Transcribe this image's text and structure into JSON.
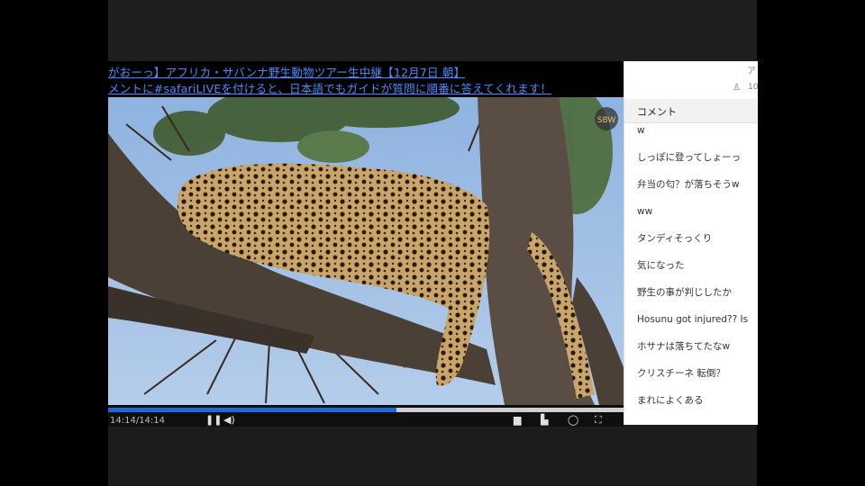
{
  "stream": {
    "title_line1": "がおーっ】アフリカ・サバンナ野生動物ツアー生中継【12月7日 朝】",
    "title_line2": "メントに#safariLIVEを付けると、日本語でもガイドが質問に順番に答えてくれます！",
    "time": "14:14/14:14",
    "progress": 0.56,
    "watermark": "SBW"
  },
  "panel": {
    "corner_glyph": "ア",
    "viewer_icon": "person-icon",
    "viewer_count": "10",
    "header": "コメント"
  },
  "comments": [
    "w",
    "しっぽに登ってしょーっ",
    "弁当の匂？が落ちそうw",
    "ww",
    "タンディそっくり",
    "気になった",
    "野生の事が判じしたか",
    "Hosunu got injured?? Is",
    "ホサナは落ちてたなw",
    "クリスチーネ 転倒？",
    "まれによくある"
  ],
  "colors": {
    "banner_text": "#4a8cff",
    "progress": "#1b6bd6",
    "sky": "#9fbfe4"
  }
}
